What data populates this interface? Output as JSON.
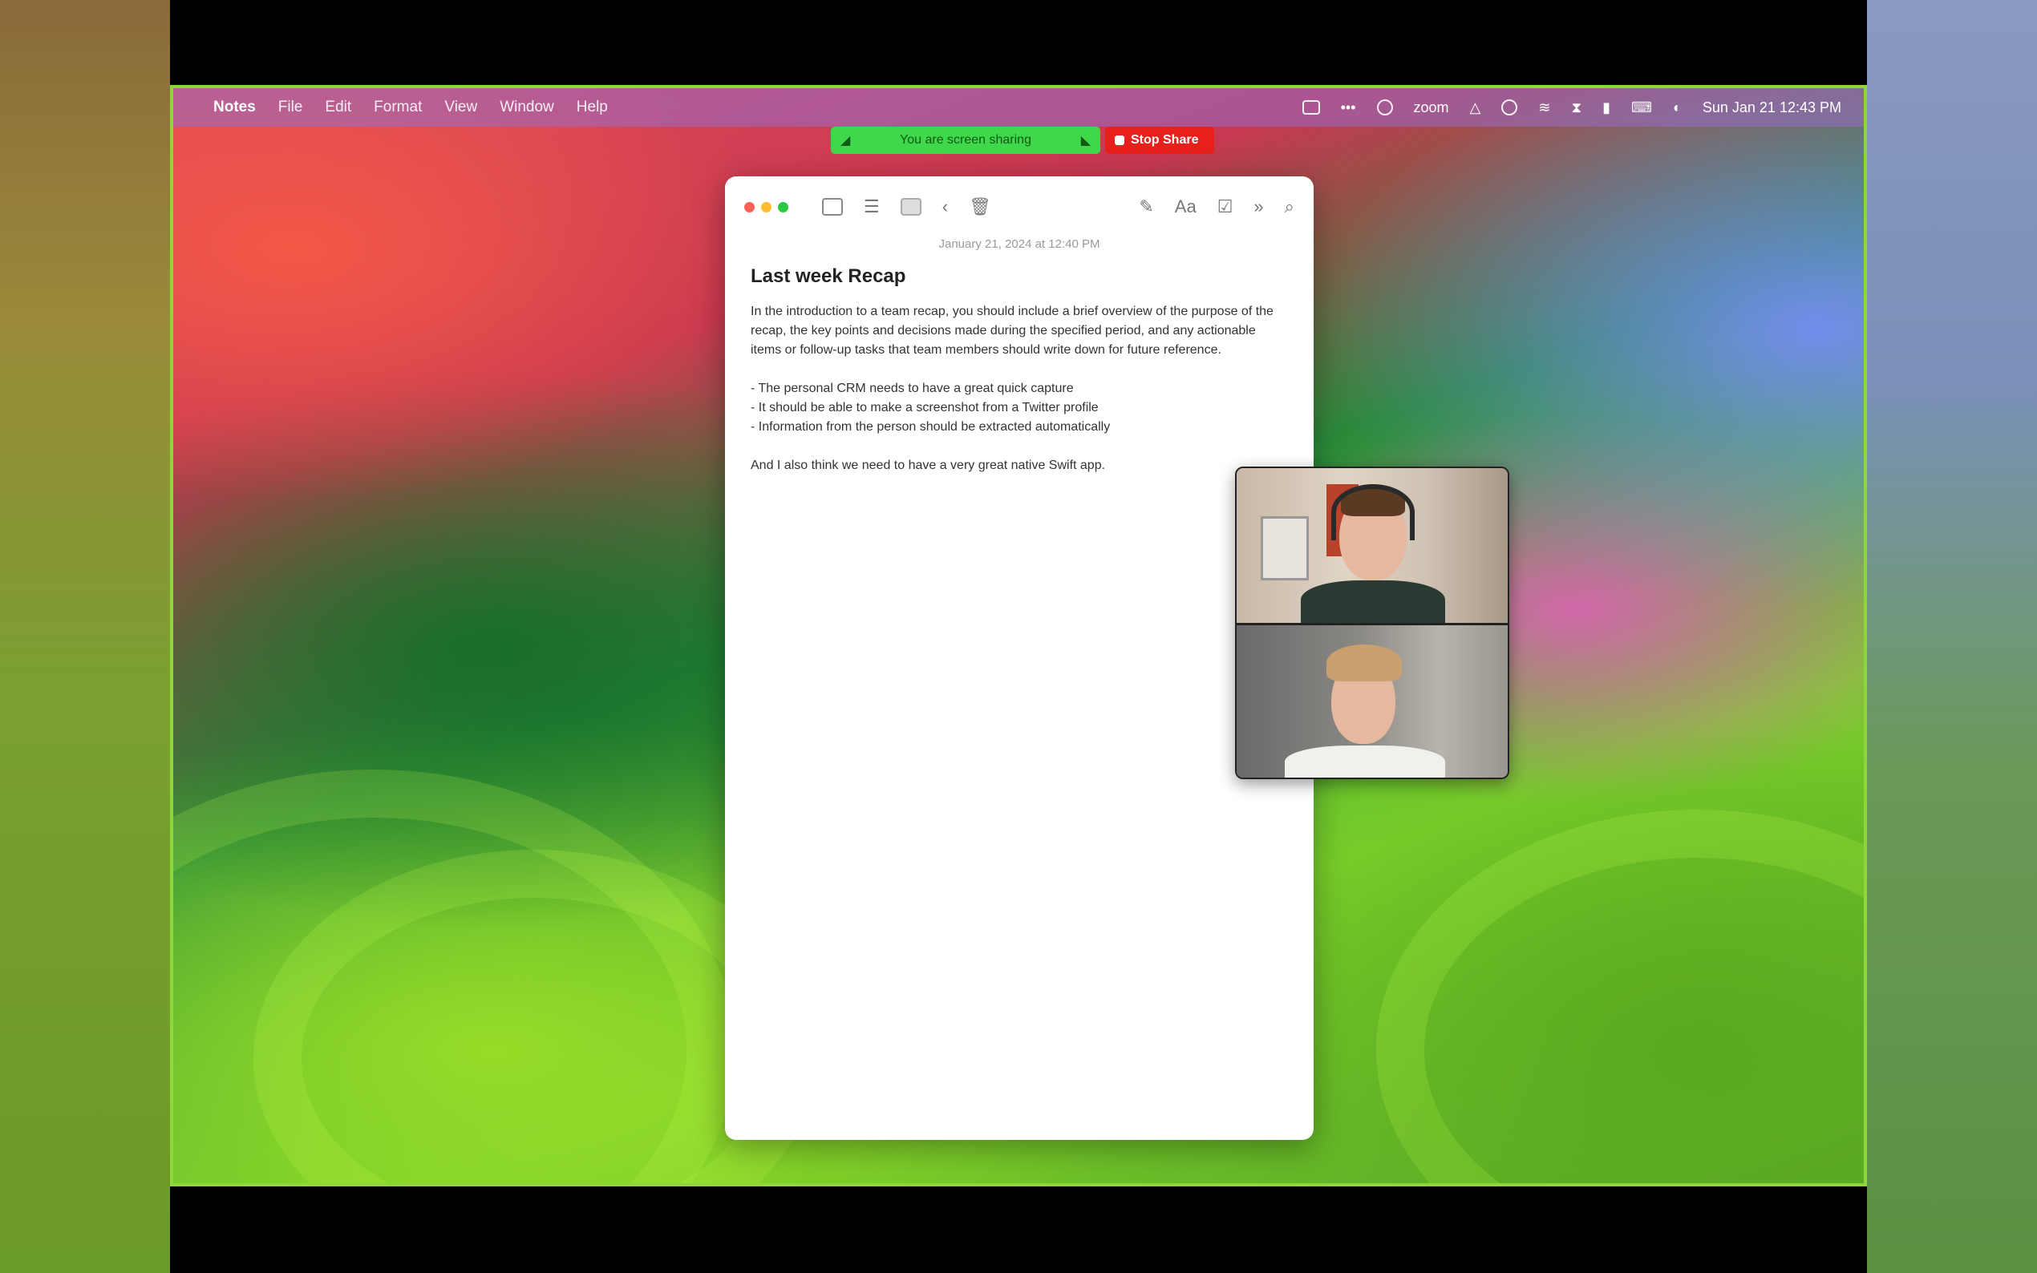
{
  "menubar": {
    "app": "Notes",
    "items": [
      "File",
      "Edit",
      "Format",
      "View",
      "Window",
      "Help"
    ],
    "zoom_label": "zoom",
    "clock": "Sun Jan 21 12:43 PM"
  },
  "sharebar": {
    "status": "You are screen sharing",
    "stop_label": "Stop Share"
  },
  "note": {
    "date": "January 21, 2024 at 12:40 PM",
    "title": "Last week Recap",
    "paragraph": "In the introduction to a team recap, you should include a brief overview of the purpose of the recap, the key points and decisions made during the specified period, and any actionable items or follow-up tasks that team members should write down for future reference.",
    "bullets": [
      "- The personal CRM needs to have a great quick capture",
      "- It should be able to make a screenshot from a Twitter profile",
      "- Information from the person should be extracted automatically"
    ],
    "closing": "And I also think we need to have a very great native Swift app."
  },
  "colors": {
    "desktop_border": "#8ed63a",
    "share_green": "#3ed84a",
    "share_red": "#e8201c",
    "traffic_red": "#ff5f57",
    "traffic_yellow": "#febc2e",
    "traffic_green": "#28c840"
  },
  "icons": {
    "toolbar": [
      "sidebar-icon",
      "list-view-icon",
      "gallery-view-icon",
      "back-icon",
      "trash-icon",
      "compose-icon",
      "format-icon",
      "checklist-icon",
      "more-icon",
      "search-icon"
    ]
  }
}
